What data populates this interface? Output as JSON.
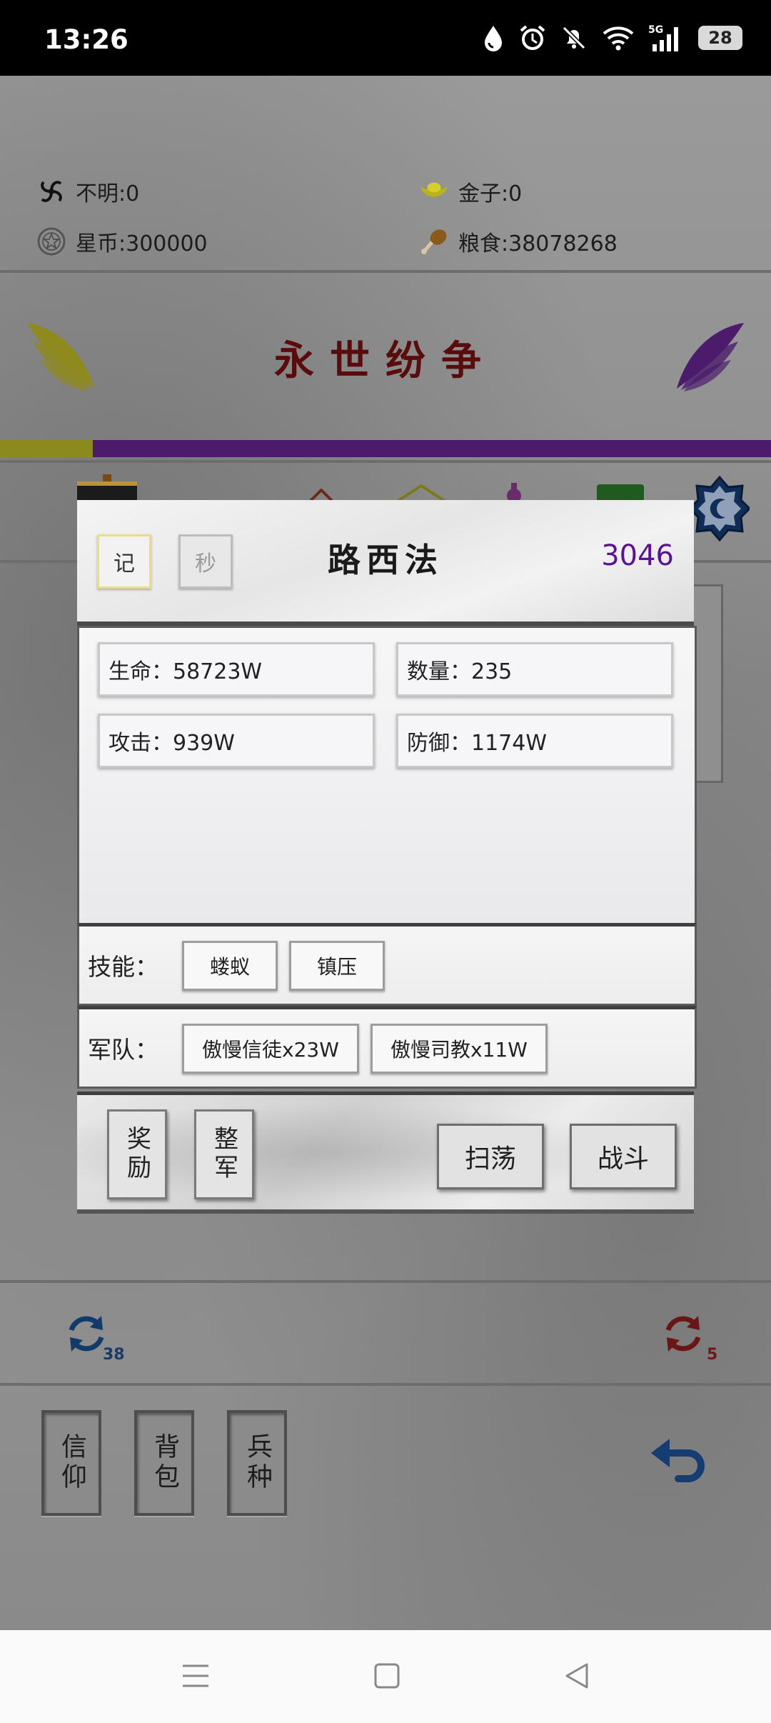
{
  "status_bar": {
    "time": "13:26",
    "battery": "28",
    "icons": [
      "drop-icon",
      "alarm-icon",
      "bell-muted-icon",
      "wifi-icon",
      "5g-signal-icon",
      "battery-icon"
    ]
  },
  "resources": {
    "unknown": "不明:0",
    "gold": "金子:0",
    "star_coin": "星币:300000",
    "food": "粮食:38078268"
  },
  "game_title": "永世纷争",
  "progress": {
    "yellow_fraction": 0.12,
    "colors": {
      "yellow": "#8a8a1e",
      "purple": "#4c1b6c"
    }
  },
  "dialog": {
    "header": {
      "record_button": "记",
      "instant_button": "秒",
      "boss_name": "路西法",
      "level": "3046"
    },
    "stats": {
      "hp": "生命：58723W",
      "count": "数量：235",
      "attack": "攻击：939W",
      "defense": "防御：1174W"
    },
    "skills": {
      "label": "技能：",
      "items": [
        "蝼蚁",
        "镇压"
      ]
    },
    "army": {
      "label": "军队：",
      "items": [
        "傲慢信徒x23W",
        "傲慢司教x11W"
      ]
    },
    "actions": {
      "reward": "奖励",
      "reorganize": "整军",
      "sweep": "扫荡",
      "battle": "战斗"
    }
  },
  "refresh": {
    "blue_count": "38",
    "red_count": "5"
  },
  "bottom_buttons": {
    "faith": "信仰",
    "bag": "背包",
    "troops": "兵种"
  },
  "colors": {
    "boss_level": "#5b1391",
    "title_red": "#5a0b0b"
  }
}
